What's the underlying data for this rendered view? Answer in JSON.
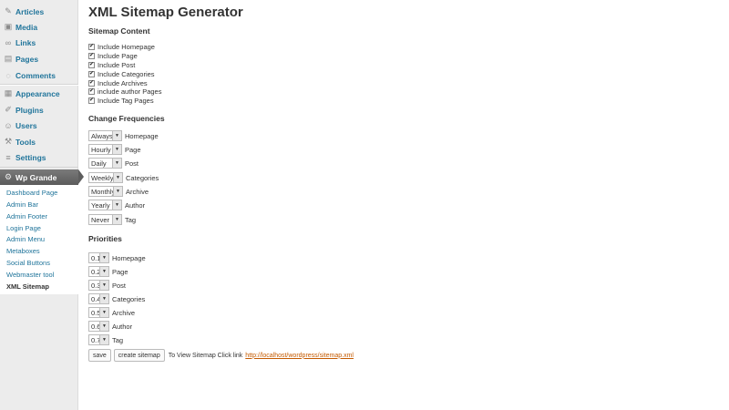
{
  "sidebar": {
    "items": [
      {
        "label": "Articles",
        "icon": "pushpin-icon",
        "glyph": "✎"
      },
      {
        "label": "Media",
        "icon": "media-icon",
        "glyph": "▣"
      },
      {
        "label": "Links",
        "icon": "link-icon",
        "glyph": "∞"
      },
      {
        "label": "Pages",
        "icon": "pages-icon",
        "glyph": "▤"
      },
      {
        "label": "Comments",
        "icon": "comments-icon",
        "glyph": "◌"
      },
      {
        "label": "Appearance",
        "icon": "appearance-icon",
        "glyph": "▦"
      },
      {
        "label": "Plugins",
        "icon": "plugins-icon",
        "glyph": "✐"
      },
      {
        "label": "Users",
        "icon": "users-icon",
        "glyph": "☺"
      },
      {
        "label": "Tools",
        "icon": "tools-icon",
        "glyph": "⚒"
      },
      {
        "label": "Settings",
        "icon": "settings-icon",
        "glyph": "≡"
      }
    ],
    "active": {
      "label": "Wp Grande",
      "icon": "gear-icon",
      "glyph": "⚙"
    },
    "submenu": [
      "Dashboard Page",
      "Admin Bar",
      "Admin Footer",
      "Login Page",
      "Admin Menu",
      "Metaboxes",
      "Social Buttons",
      "Webmaster tool",
      "XML Sitemap"
    ]
  },
  "main": {
    "title": "XML Sitemap Generator",
    "content_section": {
      "title": "Sitemap Content",
      "options": [
        {
          "label": "Include Homepage",
          "checked": true
        },
        {
          "label": "Include Page",
          "checked": true
        },
        {
          "label": "Include Post",
          "checked": true
        },
        {
          "label": "Include Categories",
          "checked": true
        },
        {
          "label": "Include Archives",
          "checked": true
        },
        {
          "label": "include author Pages",
          "checked": true
        },
        {
          "label": "Include Tag Pages",
          "checked": true
        }
      ]
    },
    "frequency_section": {
      "title": "Change Frequencies",
      "rows": [
        {
          "value": "Always",
          "label": "Homepage"
        },
        {
          "value": "Hourly",
          "label": "Page"
        },
        {
          "value": "Daily",
          "label": "Post"
        },
        {
          "value": "Weekly",
          "label": "Categories"
        },
        {
          "value": "Monthly",
          "label": "Archive"
        },
        {
          "value": "Yearly",
          "label": "Author"
        },
        {
          "value": "Never",
          "label": "Tag"
        }
      ]
    },
    "priority_section": {
      "title": "Priorities",
      "rows": [
        {
          "value": "0.1",
          "label": "Homepage"
        },
        {
          "value": "0.2",
          "label": "Page"
        },
        {
          "value": "0.3",
          "label": "Post"
        },
        {
          "value": "0.4",
          "label": "Categories"
        },
        {
          "value": "0.5",
          "label": "Archive"
        },
        {
          "value": "0.6",
          "label": "Author"
        },
        {
          "value": "0.7",
          "label": "Tag"
        }
      ]
    },
    "actions": {
      "save_label": "save",
      "create_label": "create sitemap",
      "view_text": "To View Sitemap Click link",
      "link_text": "http://localhost/wordpress/sitemap.xml"
    }
  }
}
